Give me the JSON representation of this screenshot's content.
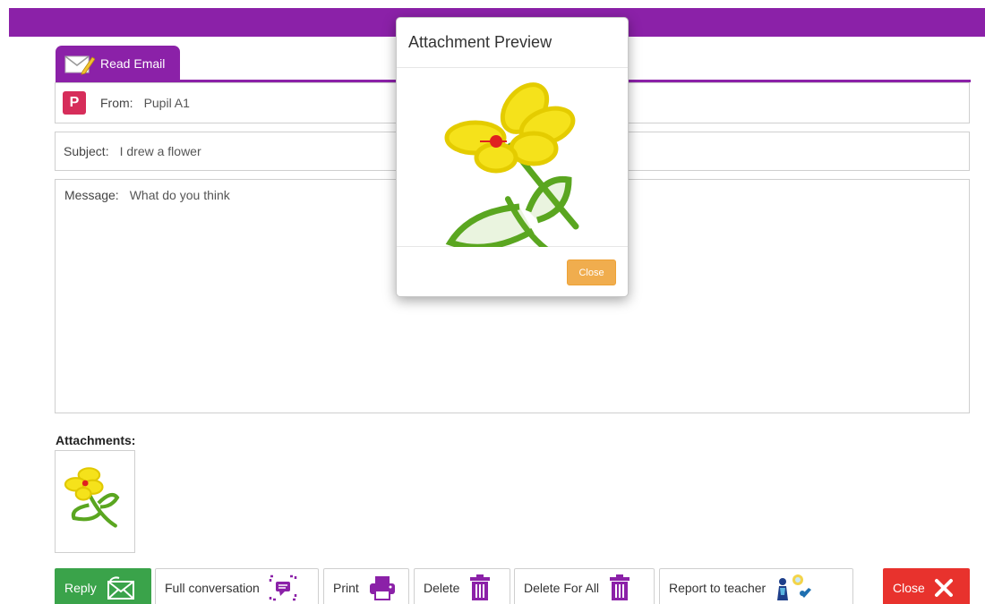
{
  "tab": {
    "label": "Read Email"
  },
  "email": {
    "avatar_letter": "P",
    "from_label": "From:",
    "from_value": "Pupil A1",
    "subject_label": "Subject:",
    "subject_value": "I drew a flower",
    "message_label": "Message:",
    "message_value": "What do you think"
  },
  "attachments": {
    "label": "Attachments:"
  },
  "buttons": {
    "reply": "Reply",
    "full_conversation": "Full conversation",
    "print": "Print",
    "delete": "Delete",
    "delete_for_all": "Delete For All",
    "report_to_teacher": "Report to teacher",
    "close": "Close"
  },
  "modal": {
    "title": "Attachment Preview",
    "close_label": "Close"
  },
  "colors": {
    "brand_purple": "#8b21a8",
    "reply_green": "#3aa34a",
    "close_red": "#e8322d",
    "modal_close_orange": "#f0ad4e",
    "avatar_pink": "#d62d5a"
  }
}
